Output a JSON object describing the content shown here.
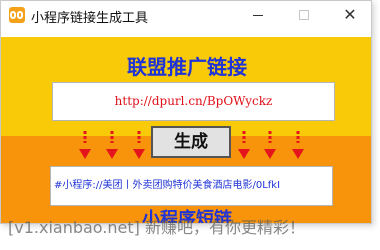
{
  "window": {
    "title": "小程序链接生成工具",
    "minimize_label": "",
    "maximize_label": "",
    "close_label": "✕"
  },
  "main": {
    "headline": "联盟推广链接",
    "long_url": "http://dpurl.cn/BpOWyckz",
    "generate_label": "生成",
    "short_link": "#小程序://美团丨外卖团购特价美食酒店电影/0LfkI",
    "footer_title": "小程序短链"
  },
  "watermark": "[v1.xianbao.net] 新赚吧，有你更精彩！",
  "colors": {
    "top_panel": "#f8ca07",
    "bottom_panel": "#f7940b",
    "headline": "#1f33d6",
    "url_text": "#e0101a",
    "arrow": "#e3141b"
  }
}
